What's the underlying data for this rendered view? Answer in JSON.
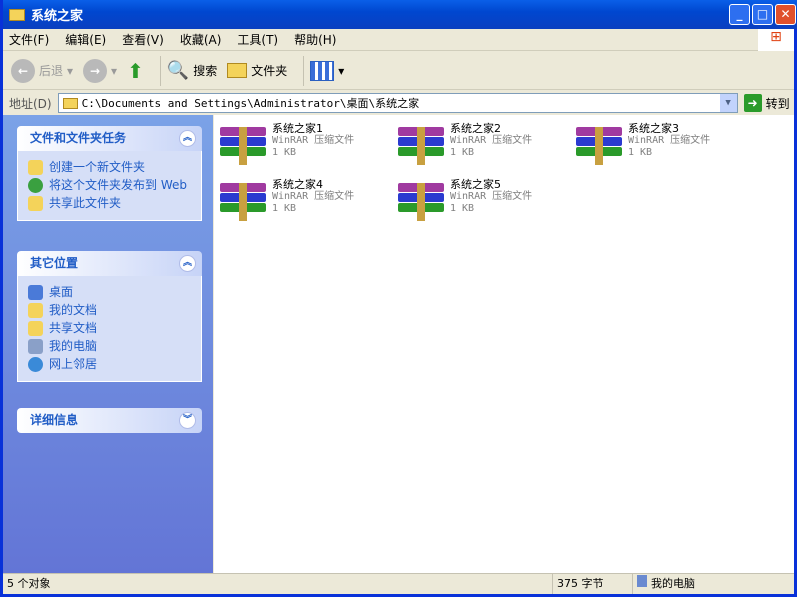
{
  "window": {
    "title": "系统之家"
  },
  "menu": [
    "文件(F)",
    "编辑(E)",
    "查看(V)",
    "收藏(A)",
    "工具(T)",
    "帮助(H)"
  ],
  "toolbar": {
    "back": "后退",
    "search": "搜索",
    "folders": "文件夹"
  },
  "address": {
    "label": "地址(D)",
    "value": "C:\\Documents and Settings\\Administrator\\桌面\\系统之家",
    "go": "转到"
  },
  "sidebar": {
    "tasks": {
      "title": "文件和文件夹任务",
      "items": [
        "创建一个新文件夹",
        "将这个文件夹发布到 Web",
        "共享此文件夹"
      ]
    },
    "places": {
      "title": "其它位置",
      "items": [
        "桌面",
        "我的文档",
        "共享文档",
        "我的电脑",
        "网上邻居"
      ]
    },
    "details": {
      "title": "详细信息"
    }
  },
  "files": [
    {
      "name": "系统之家1",
      "type": "WinRAR 压缩文件",
      "size": "1 KB"
    },
    {
      "name": "系统之家2",
      "type": "WinRAR 压缩文件",
      "size": "1 KB"
    },
    {
      "name": "系统之家3",
      "type": "WinRAR 压缩文件",
      "size": "1 KB"
    },
    {
      "name": "系统之家4",
      "type": "WinRAR 压缩文件",
      "size": "1 KB"
    },
    {
      "name": "系统之家5",
      "type": "WinRAR 压缩文件",
      "size": "1 KB"
    }
  ],
  "status": {
    "count": "5 个对象",
    "bytes": "375 字节",
    "location": "我的电脑"
  }
}
